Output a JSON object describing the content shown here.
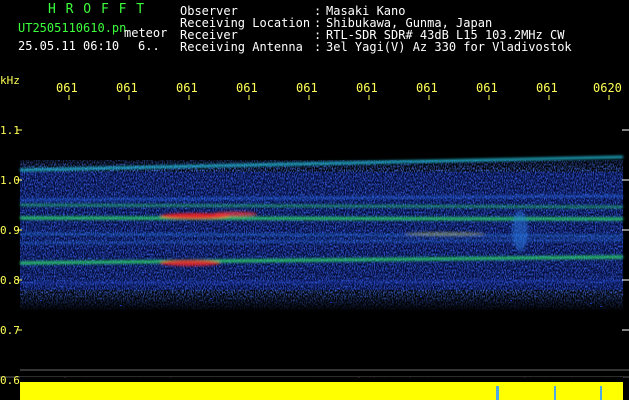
{
  "app_title": "H R O F F T",
  "file_name": "UT2505110610.pn",
  "file_suffix": "meteor",
  "datetime": "25.05.11 06:10",
  "extra": "6..",
  "header": [
    {
      "label": "Observer",
      "sep": ":",
      "value": "Masaki Kano"
    },
    {
      "label": "Receiving Location",
      "sep": ":",
      "value": "Shibukawa, Gunma, Japan"
    },
    {
      "label": "Receiver",
      "sep": ":",
      "value": "RTL-SDR SDR# 43dB L15 103.2MHz CW"
    },
    {
      "label": "Receiving Antenna",
      "sep": ":",
      "value": "3el Yagi(V) Az 330 for Vladivostok"
    }
  ],
  "y_unit": "kHz",
  "x_ticks": [
    "061",
    "061",
    "061",
    "061",
    "061",
    "061",
    "061",
    "061",
    "061",
    "0620"
  ],
  "y_ticks": [
    "1.1",
    "1.0",
    "0.9",
    "0.8",
    "0.7",
    "0.6"
  ],
  "chart_data": {
    "type": "heatmap",
    "ylabel": "kHz",
    "ylim": [
      0.6,
      1.15
    ],
    "x_tick_labels": [
      "061",
      "061",
      "061",
      "061",
      "061",
      "061",
      "061",
      "061",
      "061",
      "0620"
    ],
    "y_tick_labels": [
      "1.1",
      "1.0",
      "0.9",
      "0.8",
      "0.7",
      "0.6"
    ],
    "bands_khz": [
      1.02,
      0.96,
      0.92,
      0.84
    ],
    "colors": {
      "background": "#000000",
      "noise": "#0a1c9a",
      "signal": "#ff2020",
      "level": "#ffff00"
    }
  }
}
